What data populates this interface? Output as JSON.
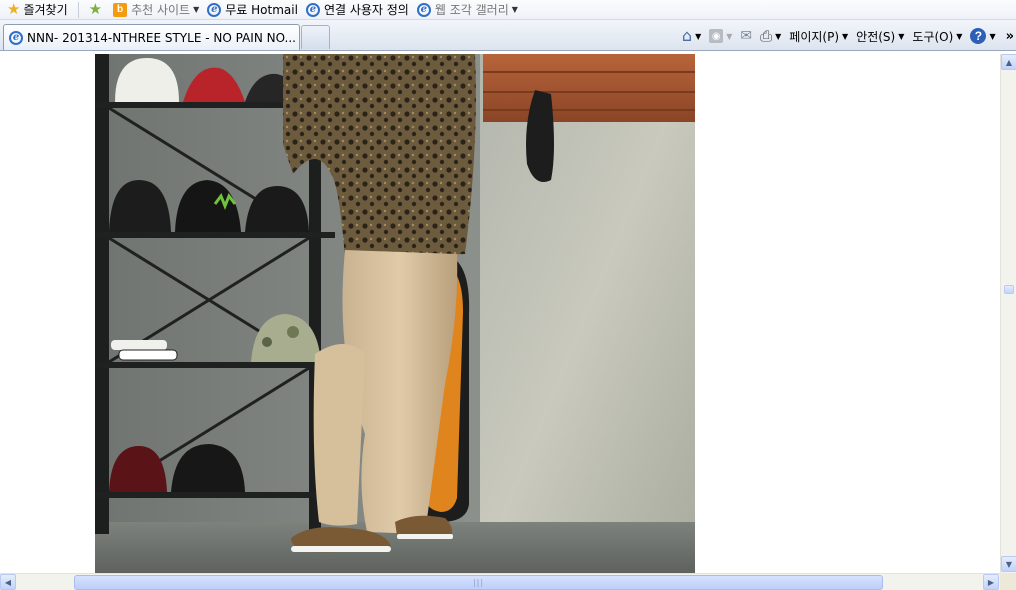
{
  "favorites_bar": {
    "favorites_label": "즐겨찾기",
    "items": [
      {
        "label": "추천 사이트",
        "icon": "bing-icon",
        "dim": true,
        "dropdown": true
      },
      {
        "label": "무료 Hotmail",
        "icon": "ie-icon",
        "dim": false,
        "dropdown": false
      },
      {
        "label": "연결 사용자 정의",
        "icon": "ie-icon",
        "dim": false,
        "dropdown": false
      },
      {
        "label": "웹 조각 갤러리",
        "icon": "ie-icon",
        "dim": true,
        "dropdown": true
      }
    ]
  },
  "tab": {
    "title": "NNN- 201314-NTHREE STYLE - NO PAIN NO..."
  },
  "command_bar": {
    "page_label": "페이지(P)",
    "safety_label": "안전(S)",
    "tools_label": "도구(O)",
    "more_glyph": "»"
  },
  "colors": {
    "chrome_bg": "#dde4ef",
    "scroll_thumb": "#c1d3fb",
    "ie_blue": "#2f6fc8"
  }
}
